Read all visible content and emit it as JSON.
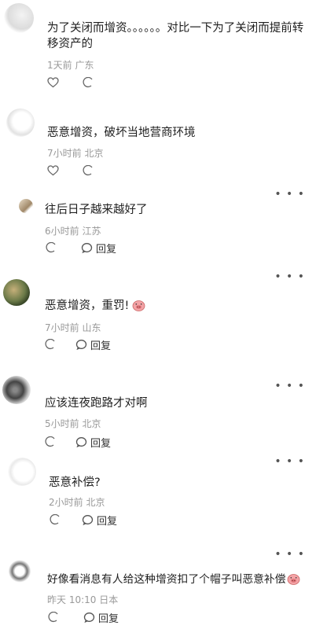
{
  "comments": [
    {
      "text": "为了关闭而增资。。。。。。对比一下为了关闭而提前转移资产的",
      "meta": "1天前 广东",
      "reply": ""
    },
    {
      "text": "恶意增资，破坏当地营商环境",
      "meta": "7小时前 北京",
      "reply": ""
    },
    {
      "text": "往后日子越来越好了",
      "meta": "6小时前 江苏",
      "reply": "回复"
    },
    {
      "text": "恶意增资，重罚!",
      "meta": "7小时前 山东",
      "reply": "回复"
    },
    {
      "text": "应该连夜跑路才对啊",
      "meta": "5小时前 北京",
      "reply": "回复"
    },
    {
      "text": "恶意补偿?",
      "meta": "2小时前 北京",
      "reply": "回复"
    },
    {
      "text": "好像看消息有人给这种增资扣了个帽子叫恶意补偿",
      "meta": "昨天 10:10 日本",
      "reply": "回复"
    }
  ],
  "more_label": "• • •",
  "icons": {
    "like": "heart-outline-icon",
    "reply": "speech-bubble-icon",
    "more": "more-dots-icon",
    "emoji": "pig-emoji-icon"
  }
}
